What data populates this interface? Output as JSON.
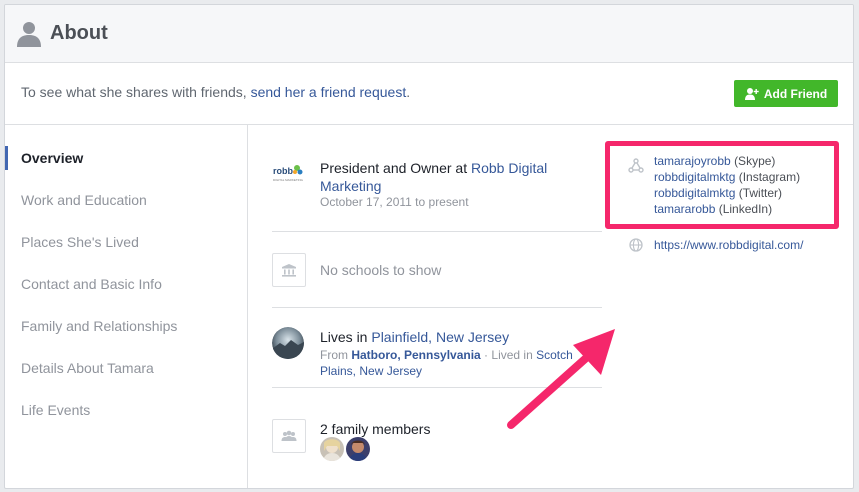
{
  "header": {
    "title": "About",
    "icon": "person-icon"
  },
  "friend_bar": {
    "prefix": "To see what she shares with friends, ",
    "link": "send her a friend request",
    "suffix": ".",
    "add_friend_label": "Add Friend"
  },
  "sidebar": {
    "items": [
      {
        "label": "Overview",
        "active": true
      },
      {
        "label": "Work and Education",
        "active": false
      },
      {
        "label": "Places She's Lived",
        "active": false
      },
      {
        "label": "Contact and Basic Info",
        "active": false
      },
      {
        "label": "Family and Relationships",
        "active": false
      },
      {
        "label": "Details About Tamara",
        "active": false
      },
      {
        "label": "Life Events",
        "active": false
      }
    ]
  },
  "overview": {
    "work": {
      "logo_text": "robb",
      "logo_subtext": "DIGITAL MARKETING",
      "title_prefix": "President and Owner at ",
      "company": "Robb Digital Marketing",
      "date": "October 17, 2011 to present"
    },
    "schools": {
      "text": "No schools to show"
    },
    "lives": {
      "prefix": "Lives in ",
      "city": "Plainfield, New Jersey",
      "from_label": "From ",
      "from_city": "Hatboro, Pennsylvania",
      "separator": " · ",
      "lived_in_label": "Lived in ",
      "lived_in_city": "Scotch Plains, New Jersey"
    },
    "family": {
      "text": "2 family members"
    }
  },
  "contact": {
    "handles": [
      {
        "handle": "tamarajoyrobb",
        "network": "(Skype)"
      },
      {
        "handle": "robbdigitalmktg",
        "network": "(Instagram)"
      },
      {
        "handle": "robbdigitalmktg",
        "network": "(Twitter)"
      },
      {
        "handle": "tamararobb",
        "network": "(LinkedIn)"
      }
    ],
    "website": "https://www.robbdigital.com/"
  },
  "colors": {
    "accent": "#365899",
    "button_green": "#42b72a",
    "highlight": "#f5276b",
    "nav_active_bar": "#4267b2"
  }
}
